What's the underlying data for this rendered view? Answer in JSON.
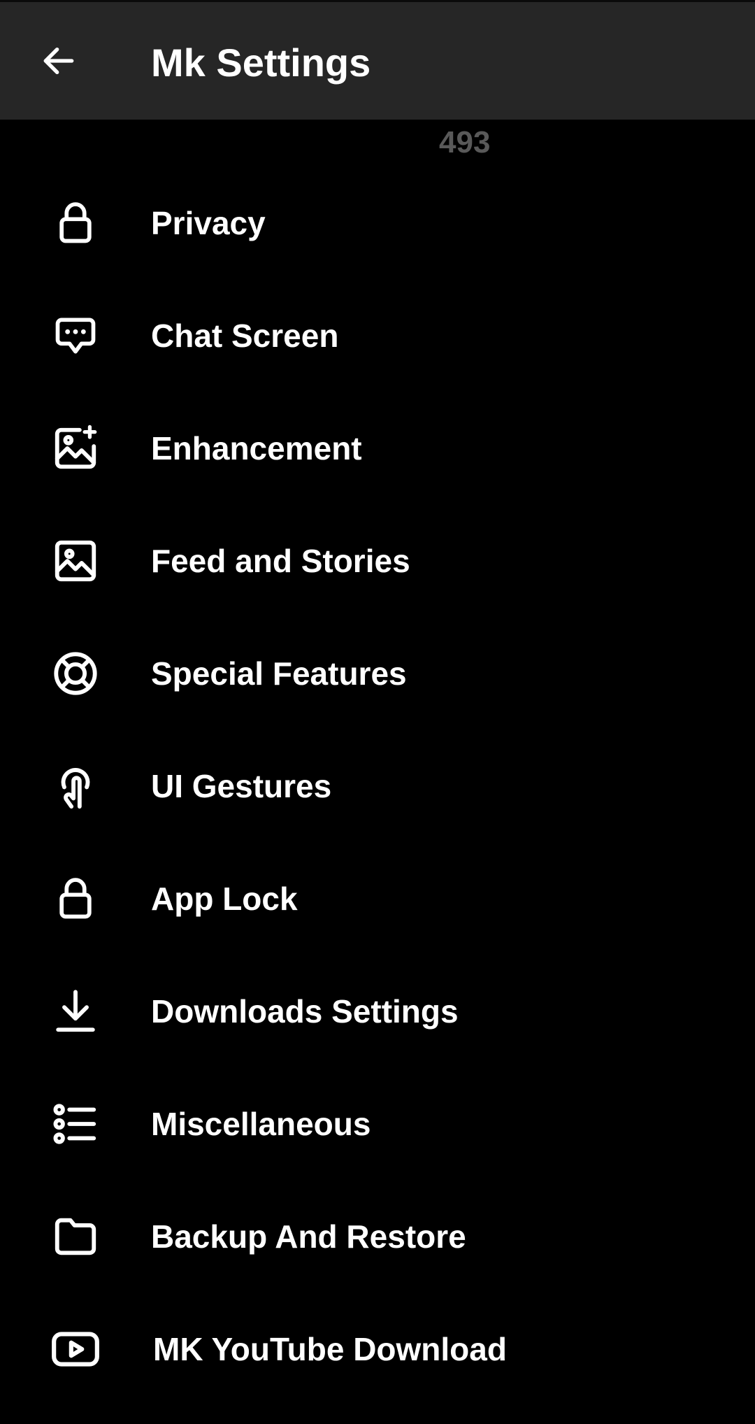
{
  "app_bar": {
    "title": "Mk Settings",
    "back_icon": "arrow-left-icon"
  },
  "partial_number": "493",
  "colors": {
    "background": "#000000",
    "app_bar": "#262626",
    "text": "#ffffff",
    "faded_text": "#595959"
  },
  "menu": {
    "items": [
      {
        "label": "Privacy",
        "icon": "lock-icon"
      },
      {
        "label": "Chat Screen",
        "icon": "chat-bubble-icon"
      },
      {
        "label": "Enhancement",
        "icon": "image-sparkle-icon"
      },
      {
        "label": "Feed and Stories",
        "icon": "image-icon"
      },
      {
        "label": "Special Features",
        "icon": "lifebuoy-icon"
      },
      {
        "label": "UI Gestures",
        "icon": "tap-gesture-icon"
      },
      {
        "label": "App Lock",
        "icon": "lock-icon"
      },
      {
        "label": "Downloads Settings",
        "icon": "download-icon"
      },
      {
        "label": "Miscellaneous",
        "icon": "list-icon"
      },
      {
        "label": "Backup And Restore",
        "icon": "folder-icon"
      },
      {
        "label": "MK YouTube Download",
        "icon": "youtube-play-icon"
      }
    ]
  }
}
